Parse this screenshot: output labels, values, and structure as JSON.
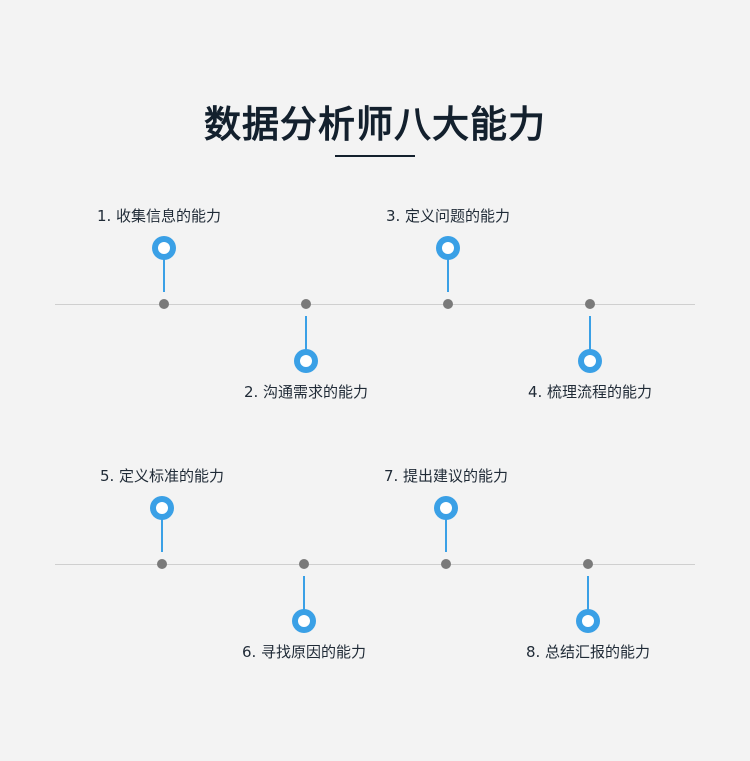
{
  "header": {
    "title": "数据分析师八大能力"
  },
  "items": [
    {
      "label": "1. 收集信息的能力"
    },
    {
      "label": "2. 沟通需求的能力"
    },
    {
      "label": "3. 定义问题的能力"
    },
    {
      "label": "4. 梳理流程的能力"
    },
    {
      "label": "5. 定义标准的能力"
    },
    {
      "label": "6. 寻找原因的能力"
    },
    {
      "label": "7. 提出建议的能力"
    },
    {
      "label": "8. 总结汇报的能力"
    }
  ],
  "colors": {
    "accent": "#3aa0e6",
    "line": "#cfcfcf",
    "dot": "#7a7a7a",
    "title": "#13202d"
  },
  "icons": {
    "pin": "location-pin-icon",
    "node": "timeline-dot-icon"
  }
}
